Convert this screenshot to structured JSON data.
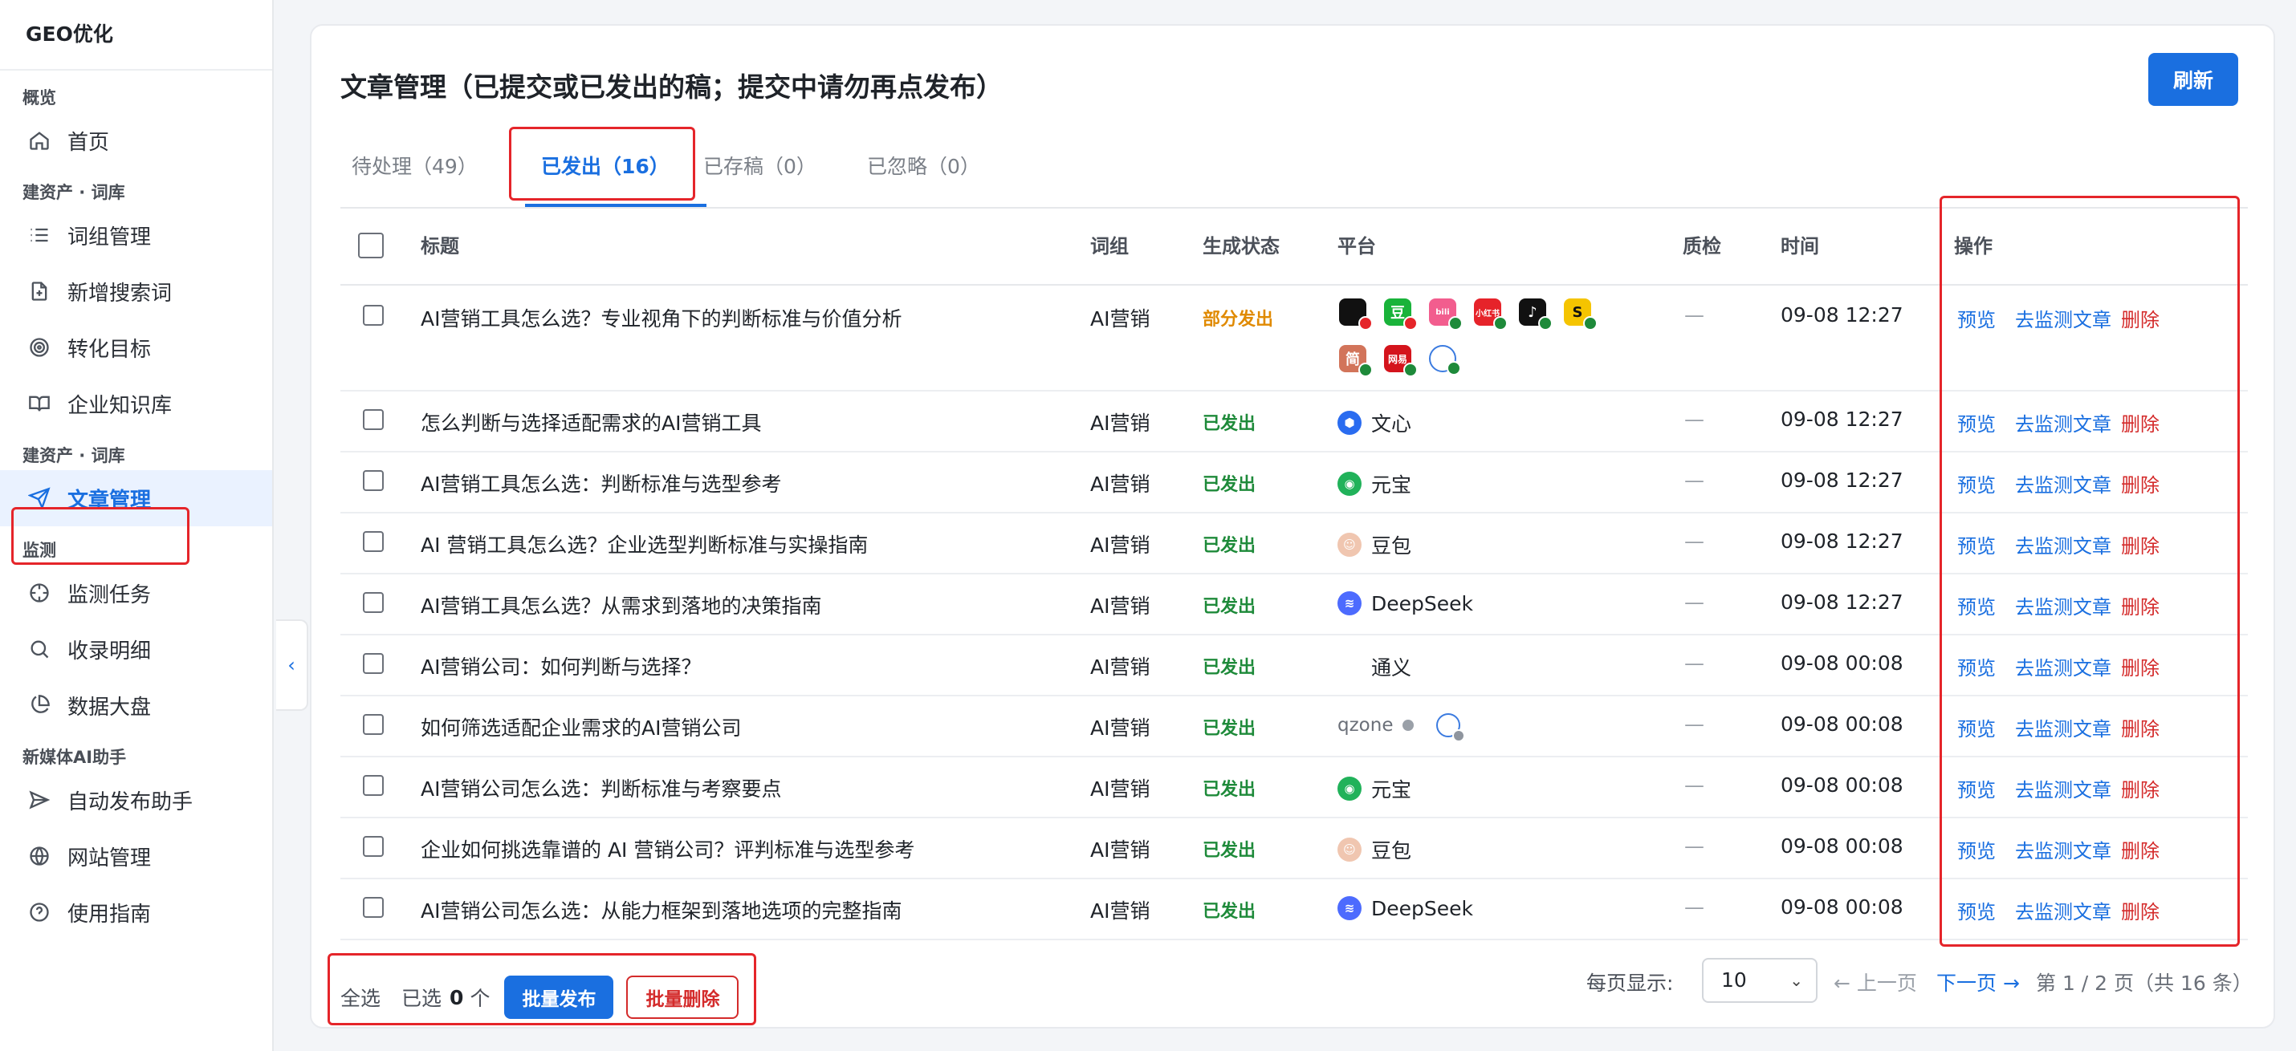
{
  "app": {
    "brand": "GEO优化"
  },
  "sidebar": {
    "sections": [
      {
        "title": "概览",
        "items": [
          {
            "label": "首页",
            "icon": "home-icon"
          }
        ]
      },
      {
        "title": "建资产 · 词库",
        "items": [
          {
            "label": "词组管理",
            "icon": "list-icon"
          },
          {
            "label": "新增搜索词",
            "icon": "file-plus-icon"
          },
          {
            "label": "转化目标",
            "icon": "target-icon"
          },
          {
            "label": "企业知识库",
            "icon": "book-icon"
          }
        ]
      },
      {
        "title": "建资产 · 词库",
        "items": [
          {
            "label": "文章管理",
            "icon": "send-icon",
            "active": true
          }
        ]
      },
      {
        "title": "监测",
        "items": [
          {
            "label": "监测任务",
            "icon": "crosshair-icon"
          },
          {
            "label": "收录明细",
            "icon": "search-icon"
          },
          {
            "label": "数据大盘",
            "icon": "pie-chart-icon"
          }
        ]
      },
      {
        "title": "新媒体AI助手",
        "items": [
          {
            "label": "自动发布助手",
            "icon": "paper-plane-icon"
          },
          {
            "label": "网站管理",
            "icon": "globe-icon"
          },
          {
            "label": "使用指南",
            "icon": "help-circle-icon"
          }
        ]
      }
    ],
    "collapse_icon": "‹"
  },
  "main": {
    "title": "文章管理（已提交或已发出的稿；提交中请勿再点发布）",
    "refresh_label": "刷新",
    "tabs": [
      {
        "label": "待处理（49）"
      },
      {
        "label": "已发出（16）",
        "active": true
      },
      {
        "label": "已存稿（0）"
      },
      {
        "label": "已忽略（0）"
      }
    ],
    "columns": {
      "title": "标题",
      "group": "词组",
      "status": "生成状态",
      "platform": "平台",
      "qc": "质检",
      "time": "时间",
      "actions": "操作"
    },
    "actions": {
      "preview": "预览",
      "monitor": "去监测文章",
      "delete": "删除"
    },
    "rows": [
      {
        "title": "AI营销工具怎么选？专业视角下的判断标准与价值分析",
        "group": "AI营销",
        "status": "部分发出",
        "status_type": "partial",
        "platform": "",
        "qc": "—",
        "time": "09-08 12:27"
      },
      {
        "title": "怎么判断与选择适配需求的AI营销工具",
        "group": "AI营销",
        "status": "已发出",
        "status_type": "sent",
        "platform": "文心",
        "qc": "—",
        "time": "09-08 12:27"
      },
      {
        "title": "AI营销工具怎么选：判断标准与选型参考",
        "group": "AI营销",
        "status": "已发出",
        "status_type": "sent",
        "platform": "元宝",
        "qc": "—",
        "time": "09-08 12:27"
      },
      {
        "title": "AI 营销工具怎么选？企业选型判断标准与实操指南",
        "group": "AI营销",
        "status": "已发出",
        "status_type": "sent",
        "platform": "豆包",
        "qc": "—",
        "time": "09-08 12:27"
      },
      {
        "title": "AI营销工具怎么选？从需求到落地的决策指南",
        "group": "AI营销",
        "status": "已发出",
        "status_type": "sent",
        "platform": "DeepSeek",
        "qc": "—",
        "time": "09-08 12:27"
      },
      {
        "title": "AI营销公司：如何判断与选择？",
        "group": "AI营销",
        "status": "已发出",
        "status_type": "sent",
        "platform": "通义",
        "qc": "—",
        "time": "09-08 00:08"
      },
      {
        "title": "如何筛选适配企业需求的AI营销公司",
        "group": "AI营销",
        "status": "已发出",
        "status_type": "sent",
        "platform": "qzone",
        "qc": "—",
        "time": "09-08 00:08"
      },
      {
        "title": "AI营销公司怎么选：判断标准与考察要点",
        "group": "AI营销",
        "status": "已发出",
        "status_type": "sent",
        "platform": "元宝",
        "qc": "—",
        "time": "09-08 00:08"
      },
      {
        "title": "企业如何挑选靠谱的 AI 营销公司？评判标准与选型参考",
        "group": "AI营销",
        "status": "已发出",
        "status_type": "sent",
        "platform": "豆包",
        "qc": "—",
        "time": "09-08 00:08"
      },
      {
        "title": "AI营销公司怎么选：从能力框架到落地选项的完整指南",
        "group": "AI营销",
        "status": "已发出",
        "status_type": "sent",
        "platform": "DeepSeek",
        "qc": "—",
        "time": "09-08 00:08"
      }
    ],
    "platform_icons_row1": [
      {
        "name": "qq-icon",
        "glyph": "",
        "color": "#111111",
        "dot": "#e5252a"
      },
      {
        "name": "douban-icon",
        "glyph": "豆",
        "color": "#19b33a",
        "dot": "#e5252a"
      },
      {
        "name": "bilibili-icon",
        "glyph": "bili",
        "color": "#f25d8e",
        "dot": "#1e8a3a"
      },
      {
        "name": "xiaohongshu-icon",
        "glyph": "小红书",
        "color": "#e6232a",
        "dot": "#1e8a3a"
      },
      {
        "name": "douyin-icon",
        "glyph": "♪",
        "color": "#111111",
        "dot": "#1e8a3a"
      },
      {
        "name": "sohu-icon",
        "glyph": "S",
        "color": "#f5c400",
        "dot": "#1e8a3a"
      },
      {
        "name": "jianshu-icon",
        "glyph": "简",
        "color": "#d2745a",
        "dot": "#1e8a3a"
      },
      {
        "name": "netease-icon",
        "glyph": "网易",
        "color": "#d4141c",
        "dot": "#1e8a3a"
      },
      {
        "name": "link-platform-icon",
        "glyph": "",
        "color": "#ffffff",
        "dot": "#1e8a3a"
      }
    ],
    "footer": {
      "select_all": "全选",
      "selected_prefix": "已选",
      "selected_count": "0",
      "selected_suffix": "个",
      "batch_publish": "批量发布",
      "batch_delete": "批量删除",
      "per_page_label": "每页显示:",
      "per_page_value": "10",
      "prev": "← 上一页",
      "next": "下一页 →",
      "page_info": "第 1 / 2 页（共 16 条）"
    }
  },
  "colors": {
    "accent": "#1a6fe0",
    "danger": "#d42b2b",
    "success": "#1e8a3a",
    "warning": "#e08a00",
    "highlight_box": "#e5252a"
  }
}
